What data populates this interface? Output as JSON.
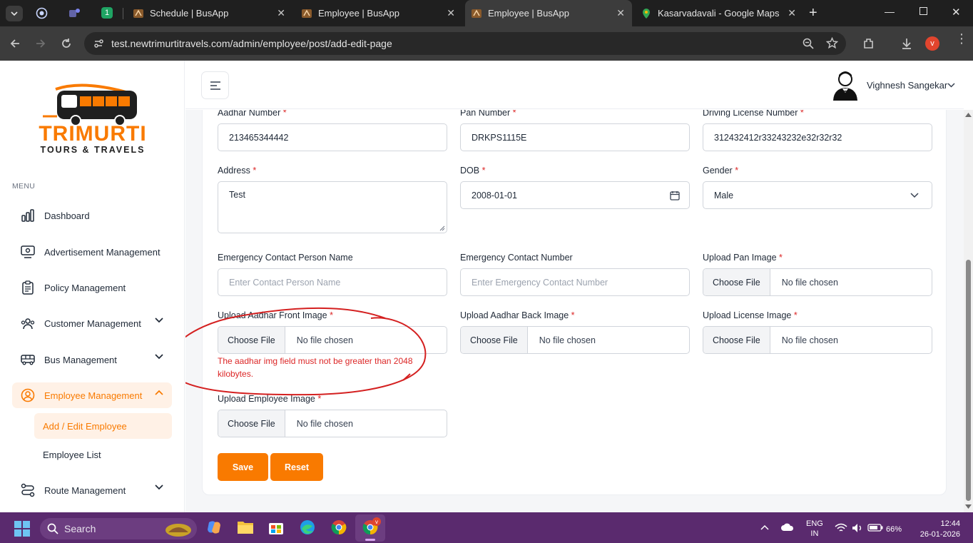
{
  "browser": {
    "tabs": [
      {
        "title": "",
        "icon": "whatsapp-icon"
      },
      {
        "title": "",
        "icon": "teams-icon"
      },
      {
        "title": "",
        "icon": "green-badge-icon",
        "badge": "1"
      },
      {
        "title": "Schedule | BusApp",
        "icon": "busapp-icon"
      },
      {
        "title": "Employee | BusApp",
        "icon": "busapp-icon"
      },
      {
        "title": "Employee | BusApp",
        "icon": "busapp-icon",
        "active": true
      },
      {
        "title": "Kasarvadavali - Google Maps",
        "icon": "maps-pin-icon"
      }
    ],
    "new_tab": "+",
    "url": "test.newtrimurtitravels.com/admin/employee/post/add-edit-page",
    "profile_initial": "v"
  },
  "sidebar": {
    "logo_line1": "TRIMURTI",
    "logo_line2": "TOURS & TRAVELS",
    "menu_label": "MENU",
    "items": [
      {
        "label": "Dashboard",
        "icon": "bar-chart-icon"
      },
      {
        "label": "Advertisement Management",
        "icon": "advertisement-icon"
      },
      {
        "label": "Policy Management",
        "icon": "clipboard-icon"
      },
      {
        "label": "Customer Management",
        "icon": "users-icon",
        "expandable": true
      },
      {
        "label": "Bus Management",
        "icon": "bus-icon",
        "expandable": true
      },
      {
        "label": "Employee Management",
        "icon": "user-circle-icon",
        "expandable": true,
        "active": true
      },
      {
        "label": "Route Management",
        "icon": "route-icon",
        "expandable": true
      }
    ],
    "subitems": [
      {
        "label": "Add / Edit Employee",
        "active": true
      },
      {
        "label": "Employee List"
      }
    ]
  },
  "header": {
    "user_name": "Vighnesh Sangekar"
  },
  "form": {
    "aadhar": {
      "label": "Aadhar Number",
      "value": "213465344442"
    },
    "pan": {
      "label": "Pan Number",
      "value": "DRKPS1115E"
    },
    "license": {
      "label": "Driving License Number",
      "value": "312432412r33243232e32r32r32"
    },
    "address": {
      "label": "Address",
      "value": "Test"
    },
    "dob": {
      "label": "DOB",
      "value": "2008-01-01"
    },
    "gender": {
      "label": "Gender",
      "value": "Male"
    },
    "emergency_name": {
      "label": "Emergency Contact Person Name",
      "placeholder": "Enter Contact Person Name"
    },
    "emergency_number": {
      "label": "Emergency Contact Number",
      "placeholder": "Enter Emergency Contact Number"
    },
    "pan_image": {
      "label": "Upload Pan Image",
      "button": "Choose File",
      "status": "No file chosen"
    },
    "aadhar_front": {
      "label": "Upload Aadhar Front Image",
      "button": "Choose File",
      "status": "No file chosen",
      "error_line1": "The aadhar img field must not be greater than 2048",
      "error_line2": "kilobytes."
    },
    "aadhar_back": {
      "label": "Upload Aadhar Back Image",
      "button": "Choose File",
      "status": "No file chosen"
    },
    "license_image": {
      "label": "Upload License Image",
      "button": "Choose File",
      "status": "No file chosen"
    },
    "employee_image": {
      "label": "Upload Employee Image",
      "button": "Choose File",
      "status": "No file chosen"
    },
    "required_mark": "*",
    "save": "Save",
    "reset": "Reset"
  },
  "taskbar": {
    "search": "Search",
    "lang1": "ENG",
    "lang2": "IN",
    "battery": "66%",
    "time": "12:44",
    "date": "26-01-2026"
  },
  "colors": {
    "accent": "#f97a00",
    "error": "#dc2626",
    "annotation": "#d42020",
    "taskbar": "#5a2a6e"
  }
}
